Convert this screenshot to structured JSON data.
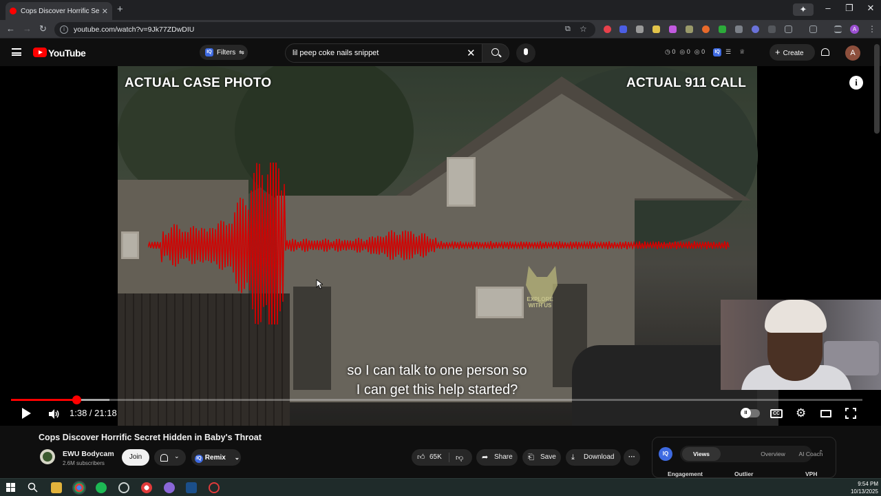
{
  "browser": {
    "tab_title": "Cops Discover Horrific Secret Hidden in Baby's Throat",
    "tab_title_display": "Cops Discover Horrific Secret Hi",
    "tab_close": "✕",
    "new_tab": "+",
    "url": "youtube.com/watch?v=9Jk77ZDwDIU",
    "profile_initial": "A"
  },
  "youtube": {
    "logo_text": "YouTube",
    "filters_label": "Filters",
    "search_query": "lil peep coke nails snippet",
    "counts": [
      "0",
      "0",
      "0"
    ],
    "create_label": "Create",
    "avatar_initial": "A"
  },
  "video": {
    "caption_left": "ACTUAL CASE PHOTO",
    "caption_right": "ACTUAL 911 CALL",
    "watermark_text": "EXPLORE\nWITH US",
    "subtitle_line1": "so I can talk to one person so",
    "subtitle_line2": "I can get this help started?",
    "current_time": "1:38",
    "duration": "21:18",
    "time_display": "1:38 / 21:18",
    "played_fraction": 0.077,
    "buffered_fraction": 0.116,
    "info_icon": "i",
    "cc_label": "CC"
  },
  "details": {
    "title": "Cops Discover Horrific Secret Hidden in Baby's Throat",
    "channel_name": "EWU Bodycam",
    "subscribers": "2.6M subscribers",
    "join_label": "Join",
    "remix_label": "Remix",
    "like_count": "65K",
    "share_label": "Share",
    "save_label": "Save",
    "download_label": "Download",
    "more_label": "···"
  },
  "iq_panel": {
    "logo": "IQ",
    "tabs": [
      "Views",
      "Overview",
      "AI Coach"
    ],
    "columns": [
      "Engagement",
      "Outlier",
      "VPH"
    ]
  },
  "taskbar": {
    "time": "9:54 PM",
    "date": "10/13/2025"
  },
  "colors": {
    "accent": "#ff0000",
    "background": "#0f0f0f",
    "iq_blue": "#3e6ae1",
    "wave": "#d40000"
  }
}
